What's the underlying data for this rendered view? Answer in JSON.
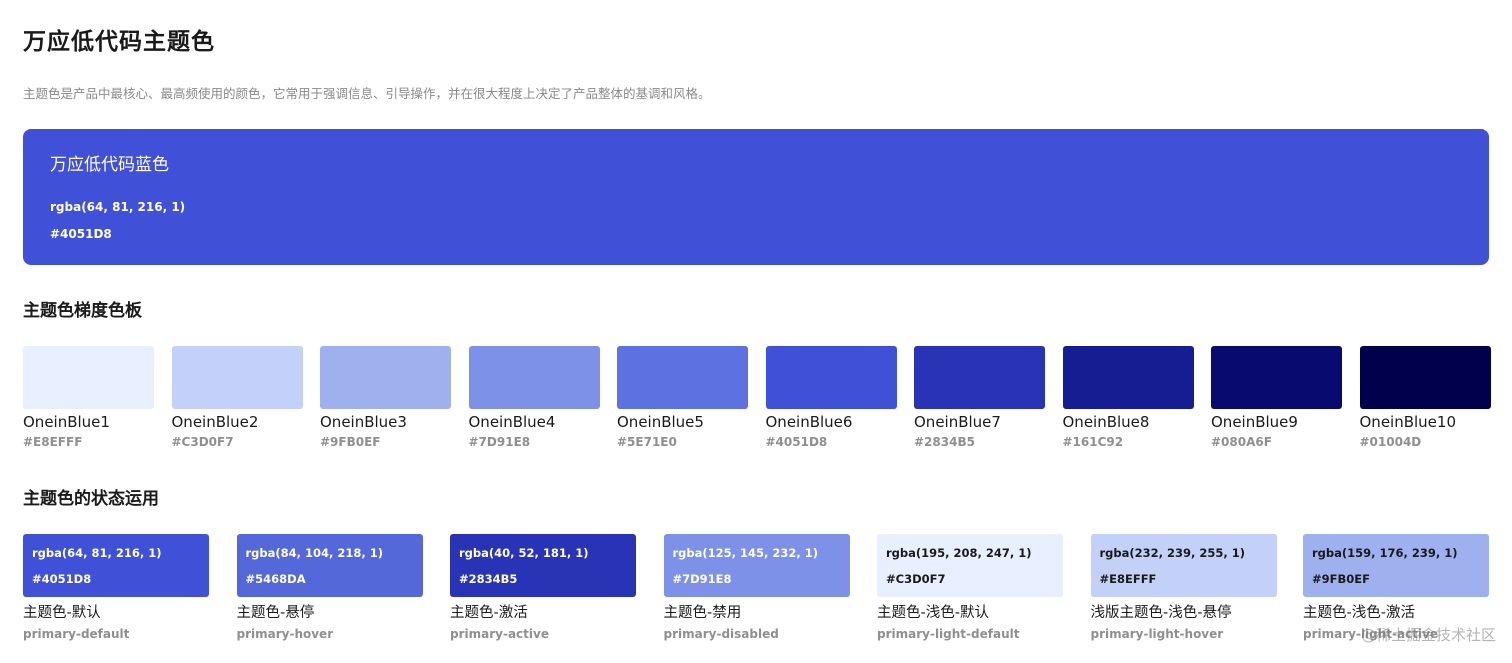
{
  "page": {
    "title": "万应低代码主题色",
    "description": "主题色是产品中最核心、最高频使用的颜色，它常用于强调信息、引导操作，并在很大程度上决定了产品整体的基调和风格。"
  },
  "hero": {
    "name": "万应低代码蓝色",
    "rgba": "rgba(64, 81, 216, 1)",
    "hex": "#4051D8",
    "color": "#4051D8"
  },
  "palette": {
    "title": "主题色梯度色板",
    "items": [
      {
        "name": "OneinBlue1",
        "hex": "#E8EFFF",
        "color": "#E8EFFF"
      },
      {
        "name": "OneinBlue2",
        "hex": "#C3D0F7",
        "color": "#C3D0F7"
      },
      {
        "name": "OneinBlue3",
        "hex": "#9FB0EF",
        "color": "#9FB0EF"
      },
      {
        "name": "OneinBlue4",
        "hex": "#7D91E8",
        "color": "#7D91E8"
      },
      {
        "name": "OneinBlue5",
        "hex": "#5E71E0",
        "color": "#5E71E0"
      },
      {
        "name": "OneinBlue6",
        "hex": "#4051D8",
        "color": "#4051D8"
      },
      {
        "name": "OneinBlue7",
        "hex": "#2834B5",
        "color": "#2834B5"
      },
      {
        "name": "OneinBlue8",
        "hex": "#161C92",
        "color": "#161C92"
      },
      {
        "name": "OneinBlue9",
        "hex": "#080A6F",
        "color": "#080A6F"
      },
      {
        "name": "OneinBlue10",
        "hex": "#01004D",
        "color": "#01004D"
      }
    ]
  },
  "states": {
    "title": "主题色的状态运用",
    "items": [
      {
        "rgba": "rgba(64, 81, 216, 1)",
        "hex": "#4051D8",
        "name": "主题色-默认",
        "token": "primary-default",
        "color": "#4051D8",
        "text_color": "#ffffff"
      },
      {
        "rgba": "rgba(84, 104, 218, 1)",
        "hex": "#5468DA",
        "name": "主题色-悬停",
        "token": "primary-hover",
        "color": "#5468DA",
        "text_color": "#ffffff"
      },
      {
        "rgba": "rgba(40, 52, 181, 1)",
        "hex": "#2834B5",
        "name": "主题色-激活",
        "token": "primary-active",
        "color": "#2834B5",
        "text_color": "#ffffff"
      },
      {
        "rgba": "rgba(125, 145, 232, 1)",
        "hex": "#7D91E8",
        "name": "主题色-禁用",
        "token": "primary-disabled",
        "color": "#7D91E8",
        "text_color": "#ffffff"
      },
      {
        "rgba": "rgba(195, 208, 247, 1)",
        "hex": "#C3D0F7",
        "name": "主题色-浅色-默认",
        "token": "primary-light-default",
        "color": "#E8EFFF",
        "text_color": "#1a1a1a"
      },
      {
        "rgba": "rgba(232, 239, 255, 1)",
        "hex": "#E8EFFF",
        "name": "浅版主题色-浅色-悬停",
        "token": "primary-light-hover",
        "color": "#C3D0F7",
        "text_color": "#1a1a1a"
      },
      {
        "rgba": "rgba(159, 176, 239, 1)",
        "hex": "#9FB0EF",
        "name": "主题色-浅色-激活",
        "token": "primary-light-active",
        "color": "#9FB0EF",
        "text_color": "#1a1a1a"
      }
    ]
  },
  "watermark": {
    "text": "@稀土掘金技术社区"
  }
}
